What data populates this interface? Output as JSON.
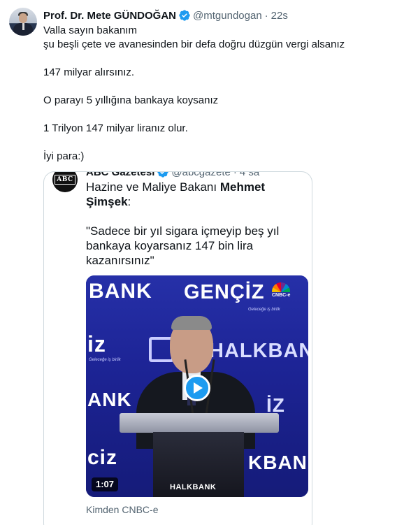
{
  "tweet": {
    "author_name": "Prof. Dr. Mete GÜNDOĞAN",
    "handle": "@mtgundogan",
    "separator": "·",
    "time": "22s",
    "lines": [
      "Valla sayın bakanım",
      "şu beşli çete ve avanesinden bir defa doğru düzgün vergi alsanız",
      "",
      "147 milyar alırsınız.",
      "",
      "O parayı 5 yıllığına bankaya koysanız",
      "",
      "1 Trilyon 147 milyar liranız olur.",
      "",
      "İyi para:)"
    ],
    "verified_color": "#1d9bf0",
    "verified_icon": "verified-badge-icon"
  },
  "quote": {
    "avatar_text": "ABC",
    "author_name": "ABC Gazetesi",
    "handle": "@abcgazete",
    "separator": "·",
    "time": "4 sa",
    "text_line1_prefix": "Hazine ve Maliye Bakanı ",
    "text_line1_bold": "Mehmet",
    "text_line2_bold": "Şimşek",
    "text_line2_suffix": ":",
    "text_lines": [
      "\"Sadece bir yıl sigara içmeyip beş yıl",
      "bankaya koyarsanız 147 bin lira",
      "kazanırsınız\""
    ],
    "media": {
      "duration": "1:07",
      "play_icon": "play-icon",
      "overlay_texts": {
        "bank_top": "BANK",
        "genciz_top": "GENÇİZ",
        "tagline_top": "Geleceğe iş birlik",
        "iz_left": "iz",
        "tagline_left": "Geleceğe iş birlik",
        "halkban": "HALKBAN",
        "ank_left": "ANK",
        "iz_right": "İZ",
        "ciz_left": "ciz",
        "kban_right": "KBAN",
        "cnbc": "CNBC-e",
        "podium_logo": "HALKBANK"
      }
    },
    "from_label": "Kimden CNBC-e"
  }
}
